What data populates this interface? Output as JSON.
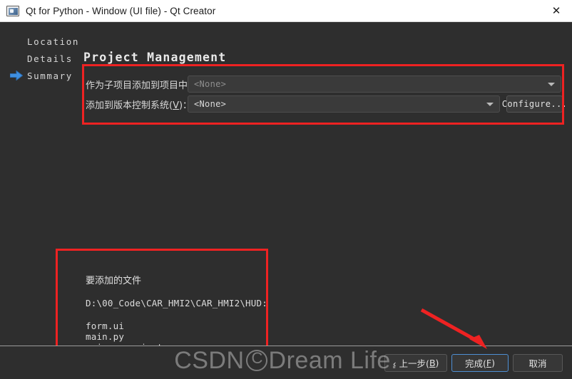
{
  "window": {
    "title": "Qt for Python - Window (UI file) - Qt Creator",
    "icon": "qt-creator-icon",
    "close_label": "✕"
  },
  "sidebar": {
    "items": [
      {
        "label": "Location",
        "active": false
      },
      {
        "label": "Details",
        "active": false
      },
      {
        "label": "Summary",
        "active": true
      }
    ],
    "arrow_icon": "blue-right-arrow-icon"
  },
  "page": {
    "title": "Project Management"
  },
  "form": {
    "rows": [
      {
        "label": "作为子项目添加到项目中：",
        "mnemonic": "",
        "value": "<None>",
        "enabled": false
      },
      {
        "label_prefix": "添加到版本控制系统(",
        "mnemonic": "V",
        "label_suffix": ")：",
        "value": "<None>",
        "enabled": true
      }
    ],
    "configure_button": "Configure..."
  },
  "files": {
    "heading": "要添加的文件",
    "path": "D:\\00_Code\\CAR_HMI2\\CAR_HMI2\\HUD:",
    "items": [
      "form.ui",
      "main.py",
      "main.pyproject"
    ]
  },
  "footer": {
    "prev_prefix": "‹ 上一步(",
    "prev_mnemonic": "B",
    "prev_suffix": ")",
    "finish_prefix": "完成(",
    "finish_mnemonic": "F",
    "finish_suffix": ")",
    "cancel": "取消"
  },
  "annotations": {
    "color": "#ee2222",
    "boxes": [
      "version-control-section",
      "files-to-add-section"
    ],
    "arrow": "red-arrow-pointing-to-finish-button"
  },
  "watermark": {
    "prefix": "CSDN ",
    "suffix": "Dream Life."
  }
}
